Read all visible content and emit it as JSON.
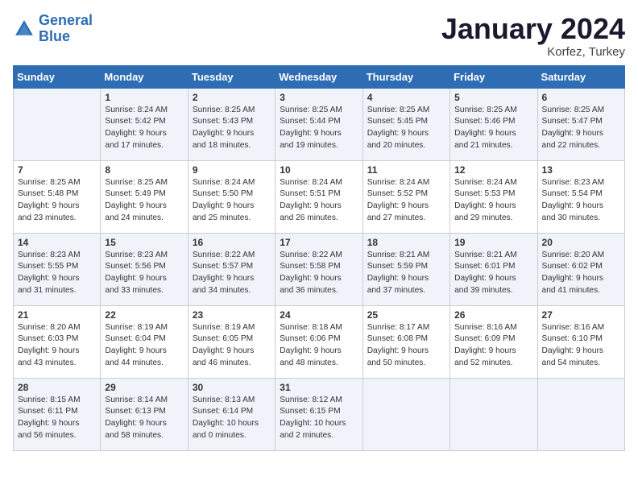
{
  "header": {
    "logo_line1": "General",
    "logo_line2": "Blue",
    "month": "January 2024",
    "location": "Korfez, Turkey"
  },
  "days_of_week": [
    "Sunday",
    "Monday",
    "Tuesday",
    "Wednesday",
    "Thursday",
    "Friday",
    "Saturday"
  ],
  "weeks": [
    [
      {
        "day": "",
        "content": ""
      },
      {
        "day": "1",
        "content": "Sunrise: 8:24 AM\nSunset: 5:42 PM\nDaylight: 9 hours\nand 17 minutes."
      },
      {
        "day": "2",
        "content": "Sunrise: 8:25 AM\nSunset: 5:43 PM\nDaylight: 9 hours\nand 18 minutes."
      },
      {
        "day": "3",
        "content": "Sunrise: 8:25 AM\nSunset: 5:44 PM\nDaylight: 9 hours\nand 19 minutes."
      },
      {
        "day": "4",
        "content": "Sunrise: 8:25 AM\nSunset: 5:45 PM\nDaylight: 9 hours\nand 20 minutes."
      },
      {
        "day": "5",
        "content": "Sunrise: 8:25 AM\nSunset: 5:46 PM\nDaylight: 9 hours\nand 21 minutes."
      },
      {
        "day": "6",
        "content": "Sunrise: 8:25 AM\nSunset: 5:47 PM\nDaylight: 9 hours\nand 22 minutes."
      }
    ],
    [
      {
        "day": "7",
        "content": "Sunrise: 8:25 AM\nSunset: 5:48 PM\nDaylight: 9 hours\nand 23 minutes."
      },
      {
        "day": "8",
        "content": "Sunrise: 8:25 AM\nSunset: 5:49 PM\nDaylight: 9 hours\nand 24 minutes."
      },
      {
        "day": "9",
        "content": "Sunrise: 8:24 AM\nSunset: 5:50 PM\nDaylight: 9 hours\nand 25 minutes."
      },
      {
        "day": "10",
        "content": "Sunrise: 8:24 AM\nSunset: 5:51 PM\nDaylight: 9 hours\nand 26 minutes."
      },
      {
        "day": "11",
        "content": "Sunrise: 8:24 AM\nSunset: 5:52 PM\nDaylight: 9 hours\nand 27 minutes."
      },
      {
        "day": "12",
        "content": "Sunrise: 8:24 AM\nSunset: 5:53 PM\nDaylight: 9 hours\nand 29 minutes."
      },
      {
        "day": "13",
        "content": "Sunrise: 8:23 AM\nSunset: 5:54 PM\nDaylight: 9 hours\nand 30 minutes."
      }
    ],
    [
      {
        "day": "14",
        "content": "Sunrise: 8:23 AM\nSunset: 5:55 PM\nDaylight: 9 hours\nand 31 minutes."
      },
      {
        "day": "15",
        "content": "Sunrise: 8:23 AM\nSunset: 5:56 PM\nDaylight: 9 hours\nand 33 minutes."
      },
      {
        "day": "16",
        "content": "Sunrise: 8:22 AM\nSunset: 5:57 PM\nDaylight: 9 hours\nand 34 minutes."
      },
      {
        "day": "17",
        "content": "Sunrise: 8:22 AM\nSunset: 5:58 PM\nDaylight: 9 hours\nand 36 minutes."
      },
      {
        "day": "18",
        "content": "Sunrise: 8:21 AM\nSunset: 5:59 PM\nDaylight: 9 hours\nand 37 minutes."
      },
      {
        "day": "19",
        "content": "Sunrise: 8:21 AM\nSunset: 6:01 PM\nDaylight: 9 hours\nand 39 minutes."
      },
      {
        "day": "20",
        "content": "Sunrise: 8:20 AM\nSunset: 6:02 PM\nDaylight: 9 hours\nand 41 minutes."
      }
    ],
    [
      {
        "day": "21",
        "content": "Sunrise: 8:20 AM\nSunset: 6:03 PM\nDaylight: 9 hours\nand 43 minutes."
      },
      {
        "day": "22",
        "content": "Sunrise: 8:19 AM\nSunset: 6:04 PM\nDaylight: 9 hours\nand 44 minutes."
      },
      {
        "day": "23",
        "content": "Sunrise: 8:19 AM\nSunset: 6:05 PM\nDaylight: 9 hours\nand 46 minutes."
      },
      {
        "day": "24",
        "content": "Sunrise: 8:18 AM\nSunset: 6:06 PM\nDaylight: 9 hours\nand 48 minutes."
      },
      {
        "day": "25",
        "content": "Sunrise: 8:17 AM\nSunset: 6:08 PM\nDaylight: 9 hours\nand 50 minutes."
      },
      {
        "day": "26",
        "content": "Sunrise: 8:16 AM\nSunset: 6:09 PM\nDaylight: 9 hours\nand 52 minutes."
      },
      {
        "day": "27",
        "content": "Sunrise: 8:16 AM\nSunset: 6:10 PM\nDaylight: 9 hours\nand 54 minutes."
      }
    ],
    [
      {
        "day": "28",
        "content": "Sunrise: 8:15 AM\nSunset: 6:11 PM\nDaylight: 9 hours\nand 56 minutes."
      },
      {
        "day": "29",
        "content": "Sunrise: 8:14 AM\nSunset: 6:13 PM\nDaylight: 9 hours\nand 58 minutes."
      },
      {
        "day": "30",
        "content": "Sunrise: 8:13 AM\nSunset: 6:14 PM\nDaylight: 10 hours\nand 0 minutes."
      },
      {
        "day": "31",
        "content": "Sunrise: 8:12 AM\nSunset: 6:15 PM\nDaylight: 10 hours\nand 2 minutes."
      },
      {
        "day": "",
        "content": ""
      },
      {
        "day": "",
        "content": ""
      },
      {
        "day": "",
        "content": ""
      }
    ]
  ]
}
